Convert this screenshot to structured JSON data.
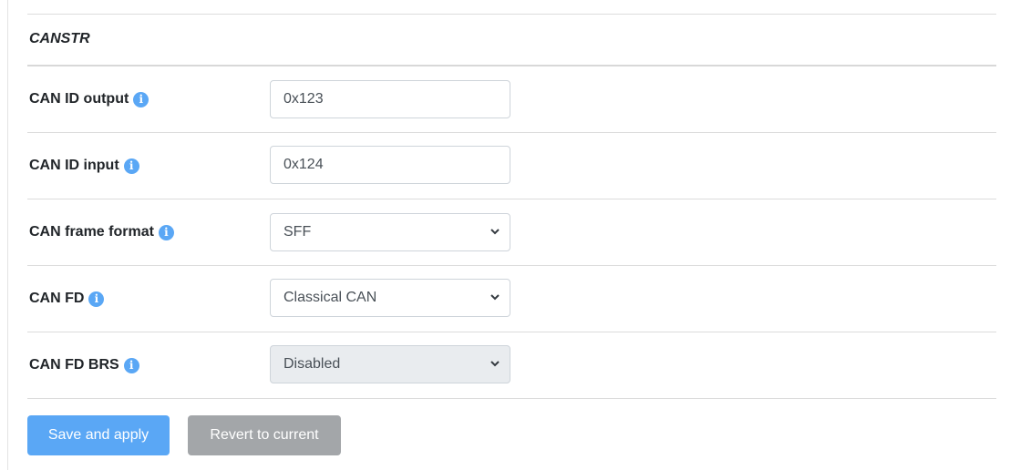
{
  "section": {
    "title": "CANSTR"
  },
  "fields": [
    {
      "label": "CAN ID output",
      "value": "0x123",
      "type": "text"
    },
    {
      "label": "CAN ID input",
      "value": "0x124",
      "type": "text"
    },
    {
      "label": "CAN frame format",
      "value": "SFF",
      "type": "select"
    },
    {
      "label": "CAN FD",
      "value": "Classical CAN",
      "type": "select"
    },
    {
      "label": "CAN FD BRS",
      "value": "Disabled",
      "type": "select",
      "disabled": true
    }
  ],
  "info_icon_glyph": "i",
  "buttons": {
    "save": "Save and apply",
    "revert": "Revert to current"
  },
  "colors": {
    "accent": "#5aa7f5",
    "secondary": "#a3a6a9",
    "disabled_bg": "#e9ecef"
  },
  "icons": {
    "info": "info-circle-icon",
    "chevron": "chevron-down-icon"
  }
}
